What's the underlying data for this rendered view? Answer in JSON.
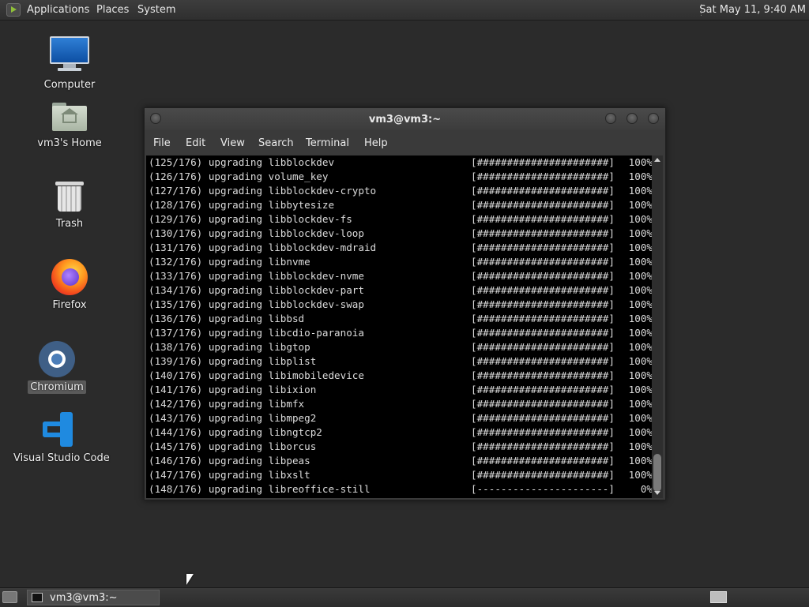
{
  "top_panel": {
    "menus": [
      "Applications",
      "Places",
      "System"
    ],
    "clock": "Sat May 11,  9:40 AM"
  },
  "desktop": {
    "icons": [
      {
        "label": "Computer",
        "icon": "computer-icon"
      },
      {
        "label": "vm3's Home",
        "icon": "home-folder-icon"
      },
      {
        "label": "Trash",
        "icon": "trash-icon"
      },
      {
        "label": "Firefox",
        "icon": "firefox-icon"
      },
      {
        "label": "Chromium",
        "icon": "chromium-icon",
        "selected": true
      },
      {
        "label": "Visual Studio Code",
        "icon": "vscode-icon"
      }
    ]
  },
  "terminal": {
    "title": "vm3@vm3:~",
    "menu": [
      "File",
      "Edit",
      "View",
      "Search",
      "Terminal",
      "Help"
    ],
    "lines": [
      {
        "text": "(125/176) upgrading libblockdev",
        "bar": "[######################]",
        "pct": "100%"
      },
      {
        "text": "(126/176) upgrading volume_key",
        "bar": "[######################]",
        "pct": "100%"
      },
      {
        "text": "(127/176) upgrading libblockdev-crypto",
        "bar": "[######################]",
        "pct": "100%"
      },
      {
        "text": "(128/176) upgrading libbytesize",
        "bar": "[######################]",
        "pct": "100%"
      },
      {
        "text": "(129/176) upgrading libblockdev-fs",
        "bar": "[######################]",
        "pct": "100%"
      },
      {
        "text": "(130/176) upgrading libblockdev-loop",
        "bar": "[######################]",
        "pct": "100%"
      },
      {
        "text": "(131/176) upgrading libblockdev-mdraid",
        "bar": "[######################]",
        "pct": "100%"
      },
      {
        "text": "(132/176) upgrading libnvme",
        "bar": "[######################]",
        "pct": "100%"
      },
      {
        "text": "(133/176) upgrading libblockdev-nvme",
        "bar": "[######################]",
        "pct": "100%"
      },
      {
        "text": "(134/176) upgrading libblockdev-part",
        "bar": "[######################]",
        "pct": "100%"
      },
      {
        "text": "(135/176) upgrading libblockdev-swap",
        "bar": "[######################]",
        "pct": "100%"
      },
      {
        "text": "(136/176) upgrading libbsd",
        "bar": "[######################]",
        "pct": "100%"
      },
      {
        "text": "(137/176) upgrading libcdio-paranoia",
        "bar": "[######################]",
        "pct": "100%"
      },
      {
        "text": "(138/176) upgrading libgtop",
        "bar": "[######################]",
        "pct": "100%"
      },
      {
        "text": "(139/176) upgrading libplist",
        "bar": "[######################]",
        "pct": "100%"
      },
      {
        "text": "(140/176) upgrading libimobiledevice",
        "bar": "[######################]",
        "pct": "100%"
      },
      {
        "text": "(141/176) upgrading libixion",
        "bar": "[######################]",
        "pct": "100%"
      },
      {
        "text": "(142/176) upgrading libmfx",
        "bar": "[######################]",
        "pct": "100%"
      },
      {
        "text": "(143/176) upgrading libmpeg2",
        "bar": "[######################]",
        "pct": "100%"
      },
      {
        "text": "(144/176) upgrading libngtcp2",
        "bar": "[######################]",
        "pct": "100%"
      },
      {
        "text": "(145/176) upgrading liborcus",
        "bar": "[######################]",
        "pct": "100%"
      },
      {
        "text": "(146/176) upgrading libpeas",
        "bar": "[######################]",
        "pct": "100%"
      },
      {
        "text": "(147/176) upgrading libxslt",
        "bar": "[######################]",
        "pct": "100%"
      },
      {
        "text": "(148/176) upgrading libreoffice-still",
        "bar": "[----------------------]",
        "pct": "0%"
      }
    ]
  },
  "bottom_panel": {
    "task_label": "vm3@vm3:~"
  },
  "colors": {
    "desktop_bg": "#2b2b2b",
    "terminal_bg": "#000000",
    "terminal_fg": "#dcdcdc",
    "panel_bg": "#333333"
  }
}
